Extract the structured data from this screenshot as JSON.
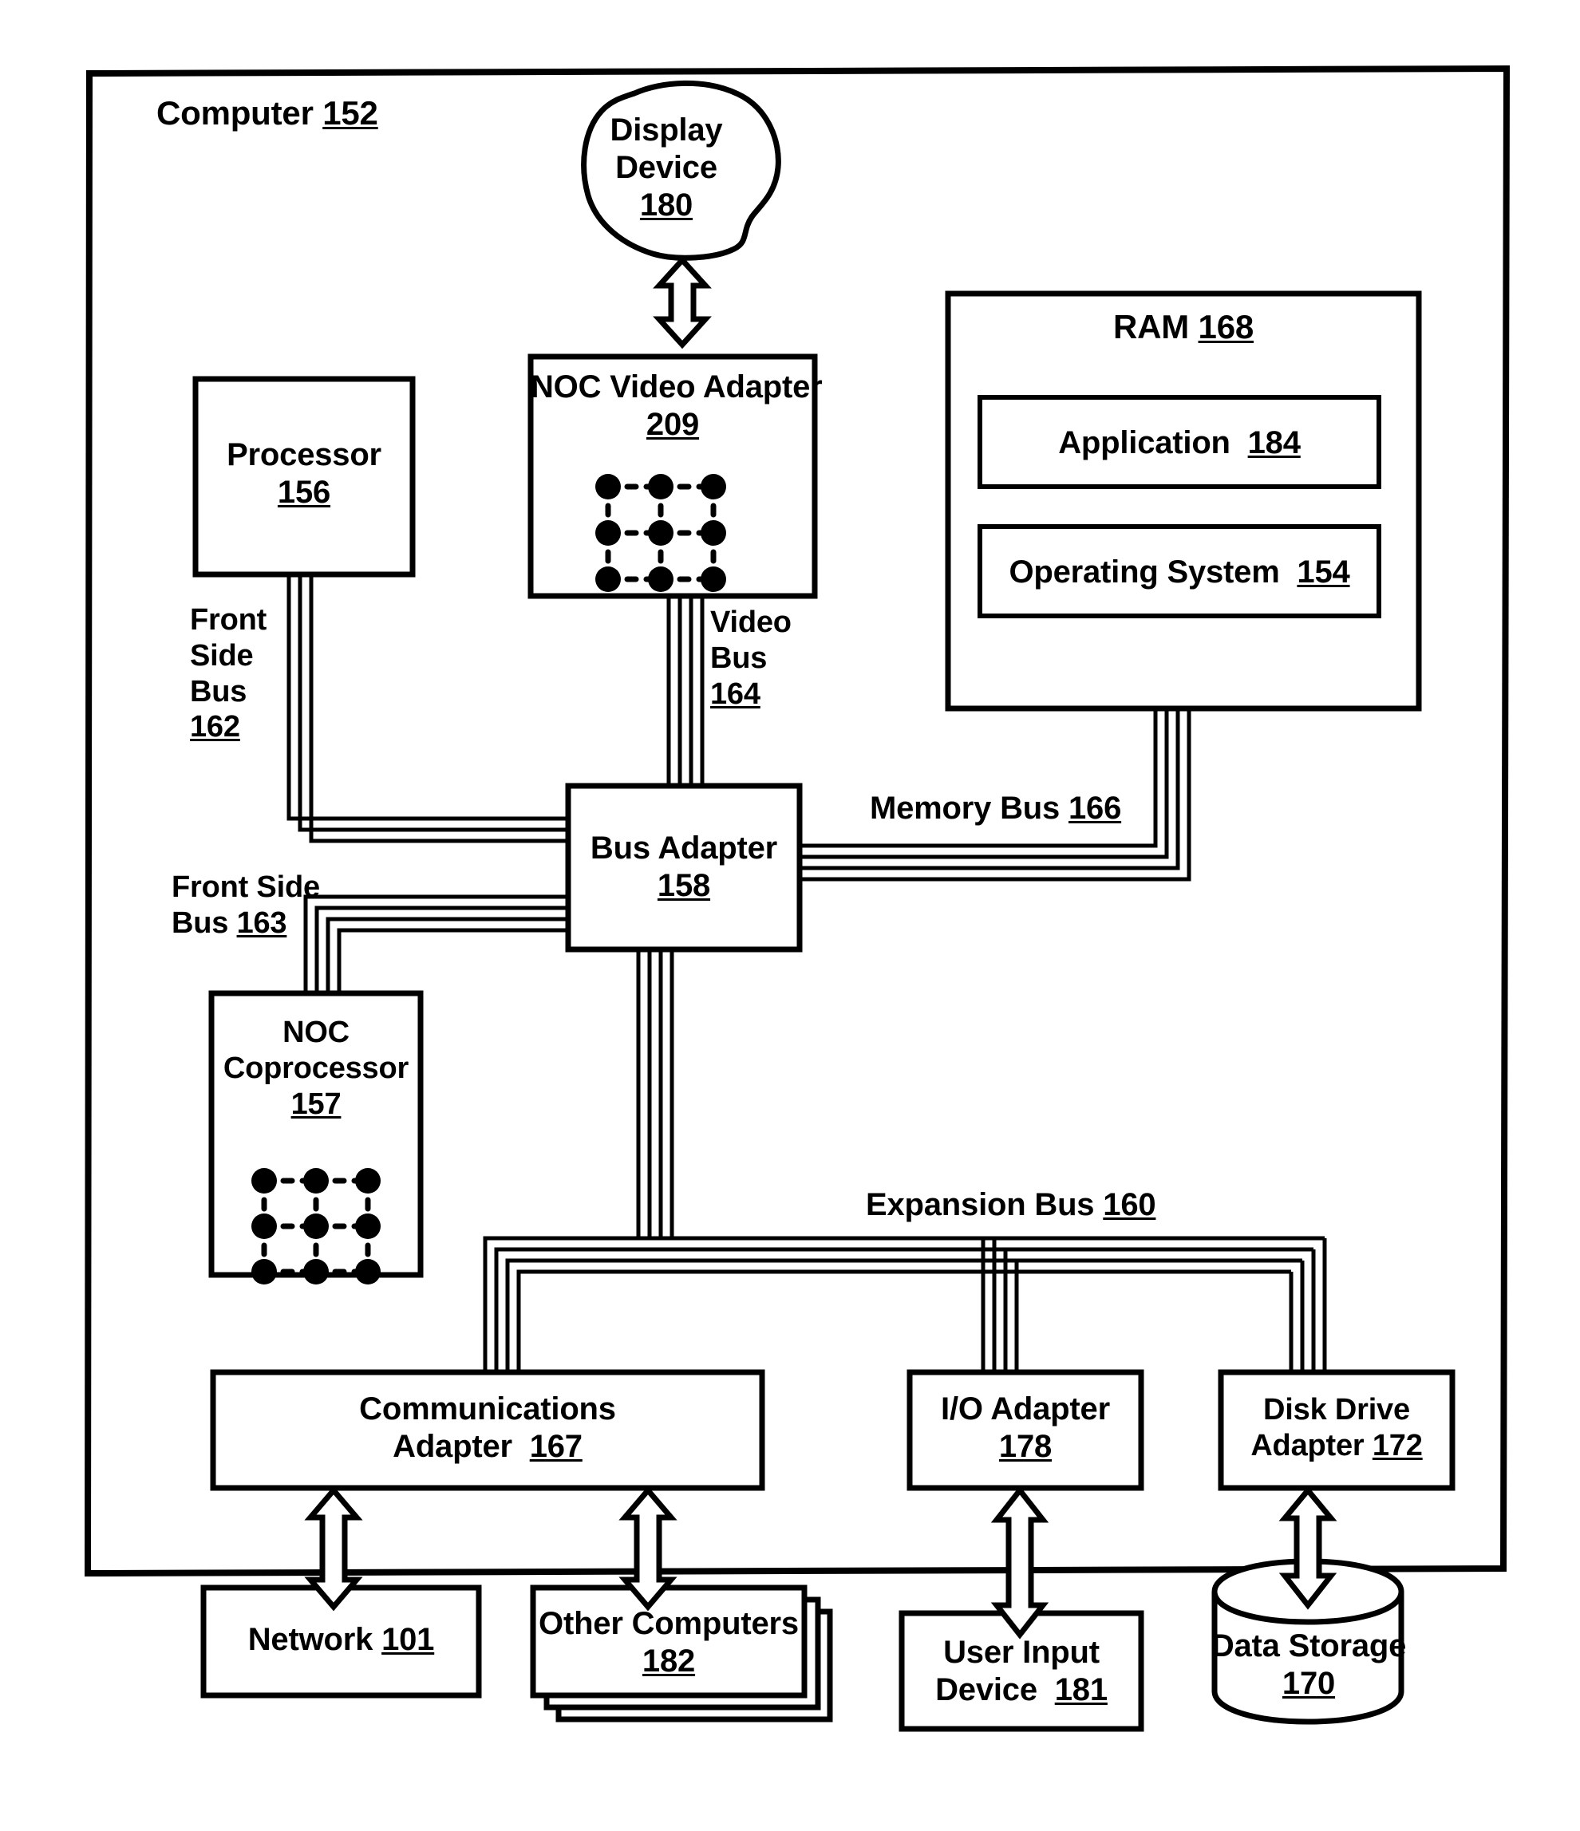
{
  "figure": {
    "type": "patent-block-diagram",
    "outer_frame_label": "Computer",
    "outer_frame_ref": "152"
  },
  "nodes": {
    "display_device": {
      "line1": "Display",
      "line2": "Device",
      "ref": "180",
      "shape": "blob"
    },
    "noc_video_adapter": {
      "line1": "NOC Video Adapter",
      "ref": "209",
      "shape": "rect",
      "mesh": "3x3"
    },
    "ram": {
      "line1": "RAM",
      "ref": "168",
      "shape": "rect"
    },
    "application": {
      "line1": "Application",
      "ref": "184",
      "shape": "rect"
    },
    "operating_system": {
      "line1": "Operating System",
      "ref": "154",
      "shape": "rect"
    },
    "processor": {
      "line1": "Processor",
      "ref": "156",
      "shape": "rect"
    },
    "bus_adapter": {
      "line1": "Bus Adapter",
      "ref": "158",
      "shape": "rect"
    },
    "noc_coprocessor": {
      "line1": "NOC",
      "line2": "Coprocessor",
      "ref": "157",
      "shape": "rect",
      "mesh": "3x3"
    },
    "communications_adapter": {
      "line1": "Communications",
      "line2": "Adapter",
      "ref": "167",
      "shape": "rect"
    },
    "io_adapter": {
      "line1": "I/O Adapter",
      "ref": "178",
      "shape": "rect"
    },
    "disk_drive_adapter": {
      "line1": "Disk Drive",
      "line2": "Adapter",
      "ref": "172",
      "shape": "rect"
    },
    "network": {
      "line1": "Network",
      "ref": "101",
      "shape": "rect"
    },
    "other_computers": {
      "line1": "Other Computers",
      "ref": "182",
      "shape": "stacked-rect"
    },
    "user_input_device": {
      "line1": "User Input",
      "line2": "Device",
      "ref": "181",
      "shape": "rect"
    },
    "data_storage": {
      "line1": "Data Storage",
      "ref": "170",
      "shape": "cylinder"
    }
  },
  "buses": {
    "front_side_bus_162": {
      "l1": "Front",
      "l2": "Side",
      "l3": "Bus",
      "ref": "162"
    },
    "video_bus_164": {
      "l1": "Video",
      "l2": "Bus",
      "ref": "164"
    },
    "memory_bus_166": {
      "l1": "Memory Bus",
      "ref": "166"
    },
    "front_side_bus_163": {
      "l1": "Front Side",
      "l2": "Bus",
      "ref": "163"
    },
    "expansion_bus_160": {
      "l1": "Expansion Bus",
      "ref": "160"
    }
  },
  "colors": {
    "ink": "#000000",
    "paper": "#ffffff"
  }
}
